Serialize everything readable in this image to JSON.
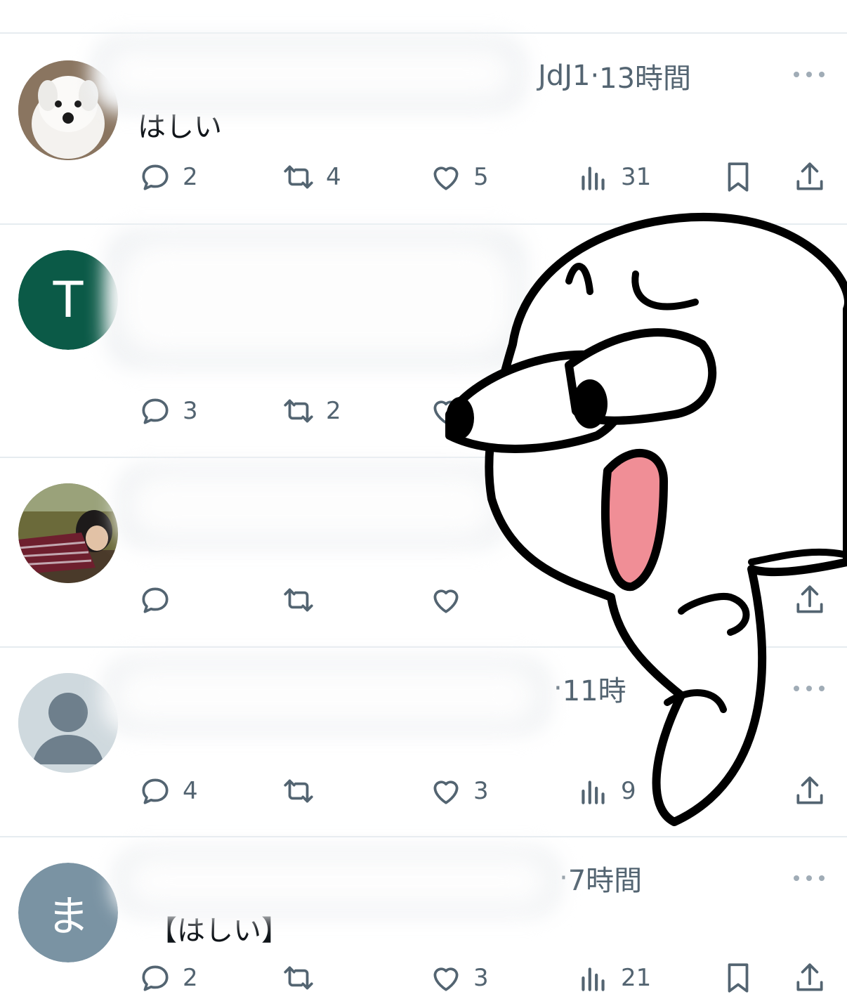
{
  "posts": [
    {
      "avatar": {
        "type": "photo",
        "desc_icon": "dog-photo-avatar",
        "letter": ""
      },
      "header_tail": "JdJ1",
      "time": "13時間",
      "text": "はしい",
      "reply": "2",
      "retweet": "4",
      "like": "5",
      "views": "31"
    },
    {
      "avatar": {
        "type": "letter",
        "letter": "T",
        "color": "#0b5a47"
      },
      "header_tail": "",
      "time": "",
      "text": "",
      "reply": "3",
      "retweet": "2",
      "like": "",
      "views": ""
    },
    {
      "avatar": {
        "type": "photo",
        "desc_icon": "person-photo-avatar",
        "letter": ""
      },
      "header_tail": "",
      "time": "",
      "text": "",
      "reply": "",
      "retweet": "",
      "like": "",
      "views": ""
    },
    {
      "avatar": {
        "type": "default",
        "desc_icon": "default-user-avatar",
        "letter": ""
      },
      "header_tail": "",
      "time": "11時",
      "text": "",
      "reply": "4",
      "retweet": "",
      "like": "3",
      "views": "9"
    },
    {
      "avatar": {
        "type": "letter",
        "letter": "ま",
        "color": "#7a93a3"
      },
      "header_tail": "",
      "time": "7時間",
      "text": "【はしい】",
      "reply": "2",
      "retweet": "",
      "like": "3",
      "views": "21"
    }
  ],
  "colors": {
    "icon_gray": "#536471",
    "divider": "#e6ecf0",
    "sticker_mouth": "#f08e96"
  }
}
